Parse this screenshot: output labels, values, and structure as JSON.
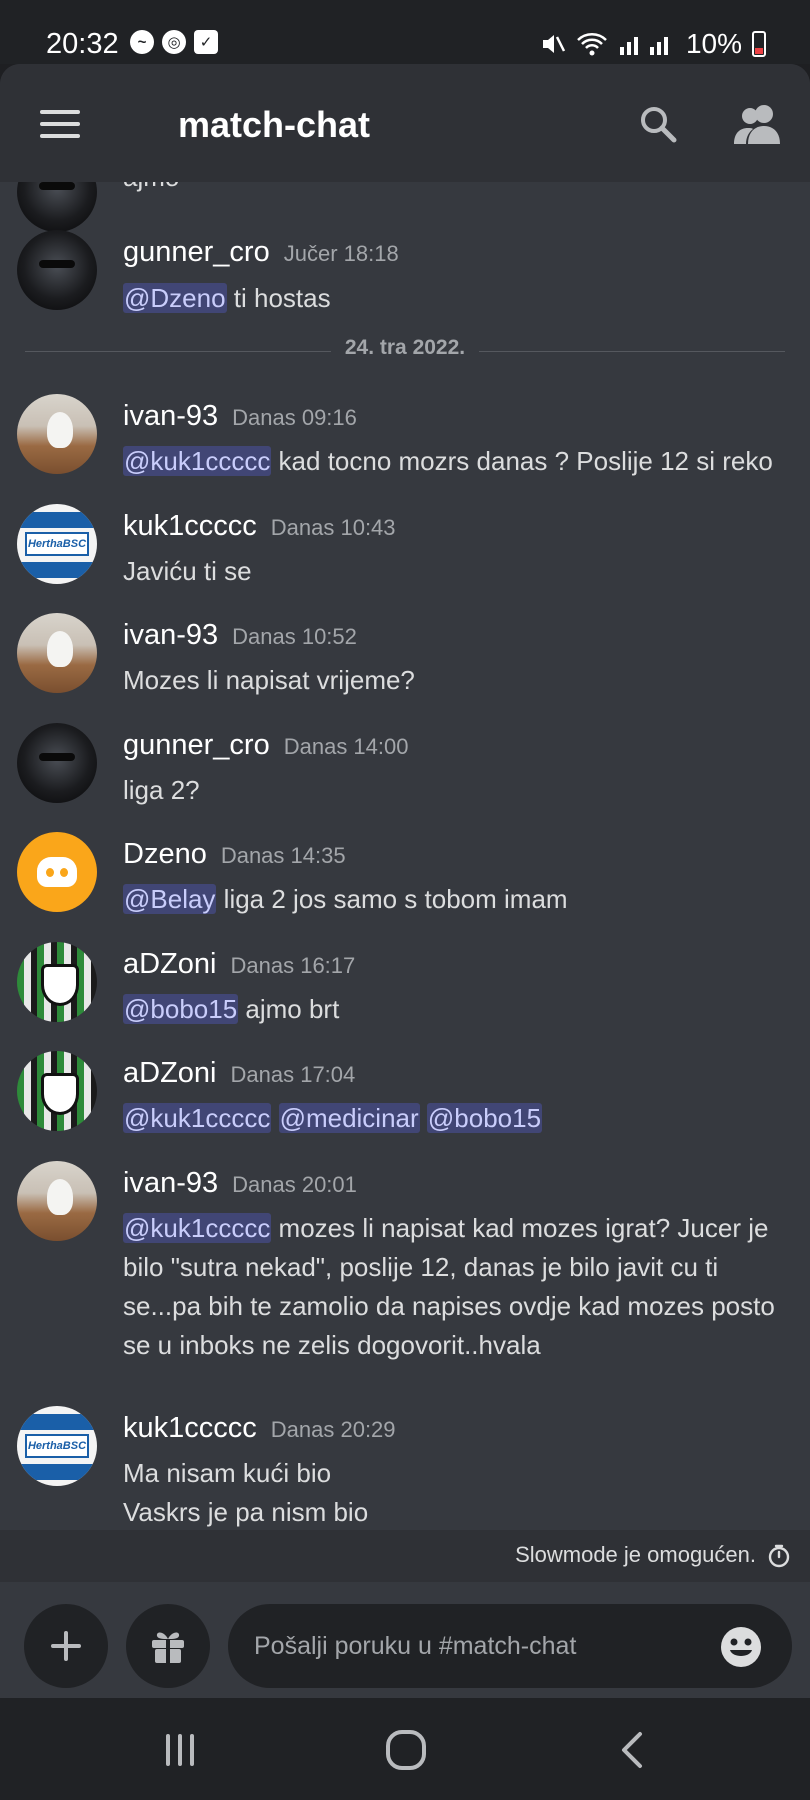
{
  "status_bar": {
    "time": "20:32",
    "battery": "10%",
    "left_icons": [
      "messenger-icon",
      "chrome-icon",
      "check-icon"
    ],
    "right_icons": [
      "mute-icon",
      "wifi-icon",
      "signal-icon"
    ]
  },
  "header": {
    "channel": "match-chat",
    "icons": [
      "menu-icon",
      "search-icon",
      "members-icon"
    ]
  },
  "messages": [
    {
      "content": [
        {
          "text": "ajmo"
        }
      ]
    },
    {
      "author": "gunner_cro",
      "time": "Jučer 18:18",
      "content": [
        {
          "mention": "@Dzeno"
        },
        {
          "text": " ti hostas"
        }
      ]
    },
    {
      "author": "ivan-93",
      "time": "Danas 09:16",
      "content": [
        {
          "mention": "@kuk1ccccc"
        },
        {
          "text": " kad tocno mozrs danas ? Poslije 12 si reko"
        }
      ]
    },
    {
      "author": "kuk1ccccc",
      "time": "Danas 10:43",
      "content": [
        {
          "text": "Javiću ti se"
        }
      ]
    },
    {
      "author": "ivan-93",
      "time": "Danas 10:52",
      "content": [
        {
          "text": "Mozes li napisat vrijeme?"
        }
      ]
    },
    {
      "author": "gunner_cro",
      "time": "Danas 14:00",
      "content": [
        {
          "text": "liga 2?"
        }
      ]
    },
    {
      "author": "Dzeno",
      "time": "Danas 14:35",
      "content": [
        {
          "mention": "@Belay"
        },
        {
          "text": " liga 2 jos samo s tobom imam"
        }
      ]
    },
    {
      "author": "aDZoni",
      "time": "Danas 16:17",
      "content": [
        {
          "mention": "@bobo15"
        },
        {
          "text": " ajmo brt"
        }
      ]
    },
    {
      "author": "aDZoni",
      "time": "Danas 17:04",
      "content": [
        {
          "mention": "@kuk1ccccc"
        },
        {
          "text": " "
        },
        {
          "mention": "@medicinar"
        },
        {
          "text": " "
        },
        {
          "mention": "@bobo15"
        }
      ]
    },
    {
      "author": "ivan-93",
      "time": "Danas 20:01",
      "content": [
        {
          "mention": "@kuk1ccccc"
        },
        {
          "text": " mozes li napisat kad mozes igrat? Jucer je bilo \"sutra nekad\", poslije 12, danas je bilo javit cu ti se...pa bih te zamolio da napises ovdje kad mozes posto se u  inboks ne zelis dogovorit..hvala"
        }
      ]
    },
    {
      "author": "kuk1ccccc",
      "time": "Danas 20:29",
      "lines": [
        "Ma nisam kući bio",
        "Vaskrs je pa nism bio"
      ]
    }
  ],
  "day_divider": "24. tra 2022.",
  "slowmode": "Slowmode je omogućen.",
  "composer": {
    "placeholder": "Pošalji poruku u #match-chat",
    "value": ""
  },
  "colors": {
    "background": "#36393f",
    "header": "#2f3136",
    "input": "#202225",
    "mention_bg": "#414675",
    "mention_text": "#c9cdfb"
  }
}
